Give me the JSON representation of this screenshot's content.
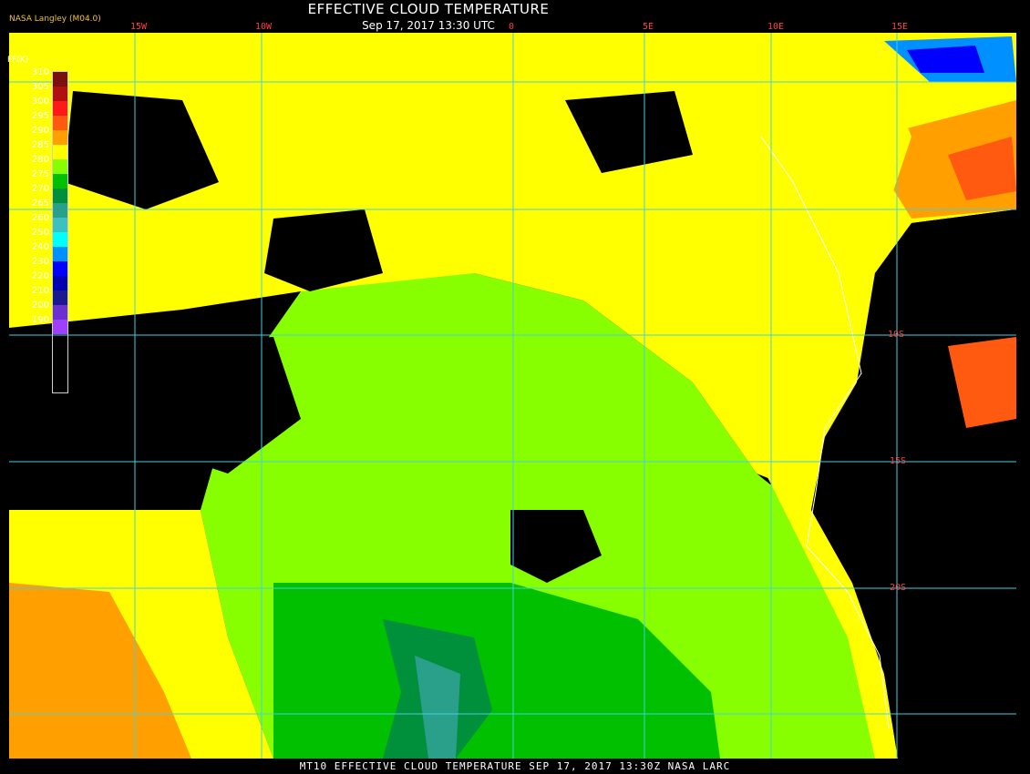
{
  "header": {
    "title": "EFFECTIVE CLOUD TEMPERATURE",
    "subtitle": "Sep 17, 2017 13:30 UTC",
    "source": "NASA Langley (M04.0)"
  },
  "legend": {
    "title": "FF(K)",
    "levels": [
      {
        "label": "310",
        "color": "#7a1010"
      },
      {
        "label": "305",
        "color": "#b01010"
      },
      {
        "label": "300",
        "color": "#ff1a1a"
      },
      {
        "label": "295",
        "color": "#ff5a10"
      },
      {
        "label": "290",
        "color": "#ffa000"
      },
      {
        "label": "285",
        "color": "#ffff00"
      },
      {
        "label": "280",
        "color": "#88ff00"
      },
      {
        "label": "275",
        "color": "#00c000"
      },
      {
        "label": "270",
        "color": "#008f3a"
      },
      {
        "label": "265",
        "color": "#2a9f8a"
      },
      {
        "label": "260",
        "color": "#3fc0c0"
      },
      {
        "label": "250",
        "color": "#00ffff"
      },
      {
        "label": "240",
        "color": "#0090ff"
      },
      {
        "label": "230",
        "color": "#0000ff"
      },
      {
        "label": "220",
        "color": "#0000b0"
      },
      {
        "label": "210",
        "color": "#1a1a90"
      },
      {
        "label": "200",
        "color": "#6a30d0"
      },
      {
        "label": "190",
        "color": "#a040ff"
      }
    ]
  },
  "grid": {
    "color": "#40d0e0",
    "longitudes": [
      "15W",
      "10W",
      "0",
      "5E",
      "10E",
      "15E"
    ],
    "latitudes": [
      "10S",
      "15S",
      "20S"
    ]
  },
  "footer": {
    "text": "MT10  EFFECTIVE CLOUD TEMPERATURE  SEP 17, 2017 13:30Z  NASA LARC"
  }
}
